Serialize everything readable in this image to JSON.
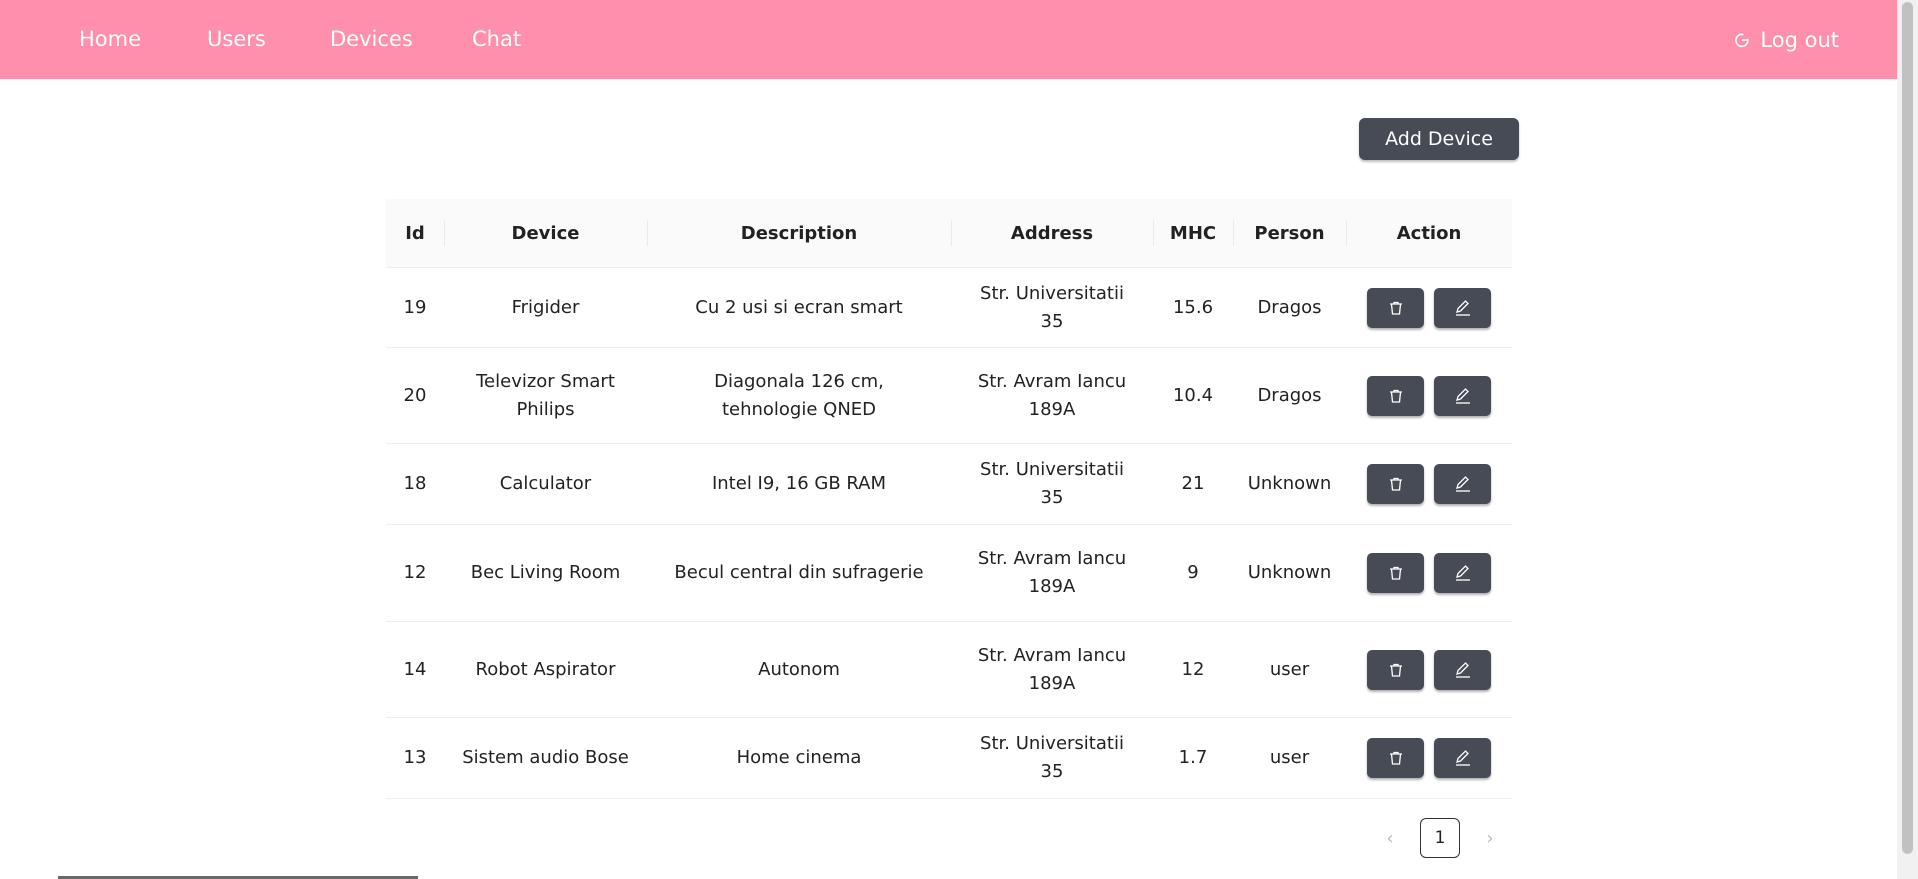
{
  "nav": {
    "items": [
      {
        "label": "Home"
      },
      {
        "label": "Users"
      },
      {
        "label": "Devices"
      },
      {
        "label": "Chat"
      }
    ],
    "logout_label": "Log out"
  },
  "colors": {
    "navbar": "#ff8fab",
    "button": "#474b55"
  },
  "add_device_label": "Add Device",
  "table": {
    "headers": [
      "Id",
      "Device",
      "Description",
      "Address",
      "MHC",
      "Person",
      "Action"
    ],
    "rows": [
      {
        "id": "19",
        "device": "Frigider",
        "description": "Cu 2 usi si ecran smart",
        "address": "Str. Universitatii 35",
        "mhc": "15.6",
        "person": "Dragos"
      },
      {
        "id": "20",
        "device": "Televizor Smart Philips",
        "description": "Diagonala 126 cm, tehnologie QNED",
        "address": "Str. Avram Iancu 189A",
        "mhc": "10.4",
        "person": "Dragos"
      },
      {
        "id": "18",
        "device": "Calculator",
        "description": "Intel I9, 16 GB RAM",
        "address": "Str. Universitatii 35",
        "mhc": "21",
        "person": "Unknown"
      },
      {
        "id": "12",
        "device": "Bec Living Room",
        "description": "Becul central din sufragerie",
        "address": "Str. Avram Iancu 189A",
        "mhc": "9",
        "person": "Unknown"
      },
      {
        "id": "14",
        "device": "Robot Aspirator",
        "description": "Autonom",
        "address": "Str. Avram Iancu 189A",
        "mhc": "12",
        "person": "user"
      },
      {
        "id": "13",
        "device": "Sistem audio Bose",
        "description": "Home cinema",
        "address": "Str. Universitatii 35",
        "mhc": "1.7",
        "person": "user"
      }
    ],
    "action_icons": [
      "trash-icon",
      "edit-icon"
    ]
  },
  "pagination": {
    "current_page": "1",
    "prev_glyph": "‹",
    "next_glyph": "›"
  }
}
